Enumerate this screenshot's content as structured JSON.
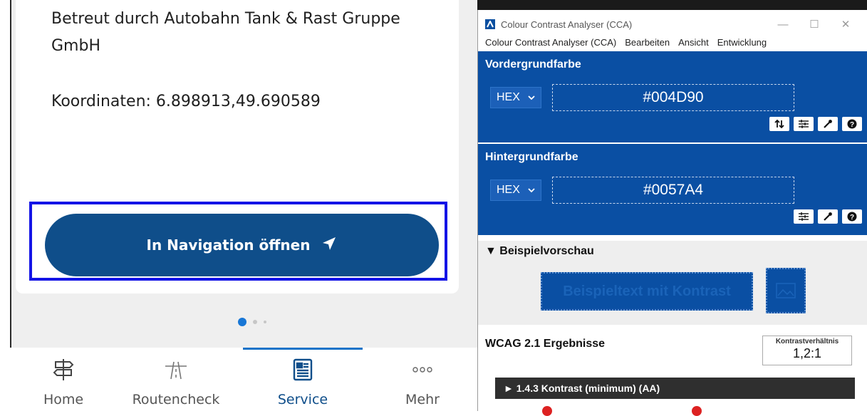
{
  "app": {
    "operator_text": "Betreut durch Autobahn Tank & Rast Gruppe GmbH",
    "coordinates_text": "Koordinaten: 6.898913,49.690589",
    "navigation_button_label": "In Navigation öffnen",
    "pager": {
      "total": 3,
      "active": 0
    },
    "tabs": [
      {
        "label": "Home",
        "icon": "signpost-icon",
        "active": false
      },
      {
        "label": "Routencheck",
        "icon": "road-icon",
        "active": false
      },
      {
        "label": "Service",
        "icon": "document-icon",
        "active": true
      },
      {
        "label": "Mehr",
        "icon": "more-dots-icon",
        "active": false
      }
    ],
    "colors": {
      "primary": "#0f4e8a",
      "highlight_border": "#1414e6",
      "active_indicator": "#1a73c9"
    }
  },
  "cca": {
    "window_title": "Colour Contrast Analyser (CCA)",
    "menu": [
      "Colour Contrast Analyser (CCA)",
      "Bearbeiten",
      "Ansicht",
      "Entwicklung"
    ],
    "foreground": {
      "title": "Vordergrundfarbe",
      "format": "HEX",
      "value": "#004D90"
    },
    "background": {
      "title": "Hintergrundfarbe",
      "format": "HEX",
      "value": "#0057A4"
    },
    "preview": {
      "title": "▼ Beispielvorschau",
      "sample_text": "Beispieltext mit Kontrast"
    },
    "results": {
      "title": "WCAG 2.1 Ergebnisse",
      "ratio_label": "Kontrastverhältnis",
      "ratio_value": "1,2:1",
      "criterion": "► 1.4.3 Kontrast (minimum) (AA)"
    },
    "colors": {
      "panel": "#0a4fa3",
      "fail": "#dd2222"
    }
  }
}
